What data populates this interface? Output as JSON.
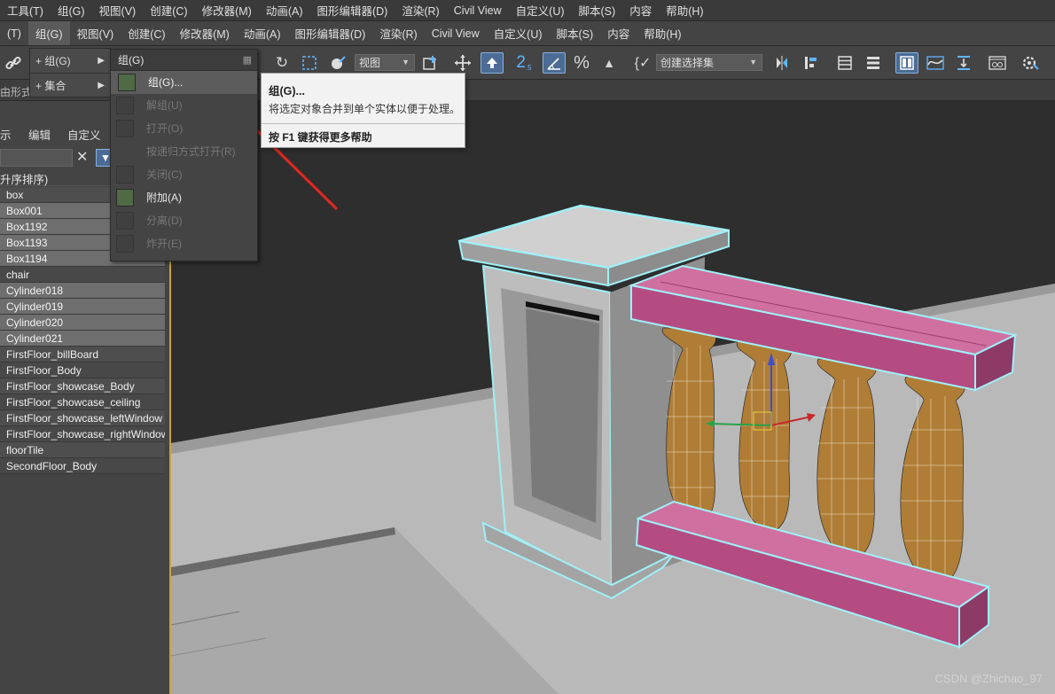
{
  "menubar_top": [
    "工具(T)",
    "组(G)",
    "视图(V)",
    "创建(C)",
    "修改器(M)",
    "动画(A)",
    "图形编辑器(D)",
    "渲染(R)",
    "Civil View",
    "自定义(U)",
    "脚本(S)",
    "内容",
    "帮助(H)"
  ],
  "menubar_main": [
    "(T)",
    "组(G)",
    "视图(V)",
    "创建(C)",
    "修改器(M)",
    "动画(A)",
    "图形编辑器(D)",
    "渲染(R)",
    "Civil View",
    "自定义(U)",
    "脚本(S)",
    "内容",
    "帮助(H)"
  ],
  "toolbar": {
    "view_dropdown": "视图",
    "selection_set_dropdown": "创建选择集",
    "icons": [
      "link-icon",
      "undo-redo-icon",
      "select-region-icon",
      "paint-selection-icon",
      "add-icon",
      "move-icon",
      "snap-icon",
      "angle-snap-icon",
      "percent-snap-icon",
      "spinner-snap-icon",
      "named-selection-icon",
      "mirror-icon",
      "align-icon",
      "layer-list-icon",
      "layers-icon",
      "toggle-panel-icon",
      "curve-editor-icon",
      "schematic-icon",
      "material-editor-icon",
      "render-setup-icon"
    ],
    "accent": "#4b6c95"
  },
  "ribbon": {
    "left_label": "由形式"
  },
  "submenu": [
    {
      "label": "+ 组(G)"
    },
    {
      "label": "+ 集合"
    }
  ],
  "group_popup": {
    "header": "组(G)",
    "items": [
      {
        "label": "组(G)...",
        "enabled": true,
        "highlighted": true,
        "icon": "group-icon"
      },
      {
        "label": "解组(U)",
        "enabled": false,
        "icon": "ungroup-icon"
      },
      {
        "label": "打开(O)",
        "enabled": false,
        "icon": "open-group-icon"
      },
      {
        "label": "按递归方式打开(R)",
        "enabled": false,
        "icon": "none"
      },
      {
        "label": "关闭(C)",
        "enabled": false,
        "icon": "close-group-icon"
      },
      {
        "label": "附加(A)",
        "enabled": true,
        "icon": "attach-icon"
      },
      {
        "label": "分离(D)",
        "enabled": false,
        "icon": "detach-icon"
      },
      {
        "label": "炸开(E)",
        "enabled": false,
        "icon": "explode-icon"
      }
    ]
  },
  "tooltip": {
    "title": "组(G)...",
    "description": "将选定对象合并到单个实体以便于处理。",
    "help": "按 F1 键获得更多帮助"
  },
  "explorer": {
    "tabs": [
      "示",
      "编辑",
      "自定义"
    ],
    "sort_header": "升序排序)",
    "objects": [
      {
        "name": "box",
        "selected": false
      },
      {
        "name": "Box001",
        "selected": true
      },
      {
        "name": "Box1192",
        "selected": true
      },
      {
        "name": "Box1193",
        "selected": true
      },
      {
        "name": "Box1194",
        "selected": true
      },
      {
        "name": "chair",
        "selected": false
      },
      {
        "name": "Cylinder018",
        "selected": true
      },
      {
        "name": "Cylinder019",
        "selected": true
      },
      {
        "name": "Cylinder020",
        "selected": true
      },
      {
        "name": "Cylinder021",
        "selected": true
      },
      {
        "name": "FirstFloor_billBoard",
        "selected": false
      },
      {
        "name": "FirstFloor_Body",
        "selected": false
      },
      {
        "name": "FirstFloor_showcase_Body",
        "selected": false
      },
      {
        "name": "FirstFloor_showcase_ceiling",
        "selected": false
      },
      {
        "name": "FirstFloor_showcase_leftWindow",
        "selected": false
      },
      {
        "name": "FirstFloor_showcase_rightWindow",
        "selected": false
      },
      {
        "name": "floorTile",
        "selected": false
      },
      {
        "name": "SecondFloor_Body",
        "selected": false
      }
    ]
  },
  "scene_colors": {
    "pillar": "#a3a3a3",
    "rail": "#c0508a",
    "baluster": "#b07d36",
    "selection_outline": "#9ff0f7",
    "floor": "#b9b9b9"
  },
  "watermark": "CSDN @Zhichao_97"
}
